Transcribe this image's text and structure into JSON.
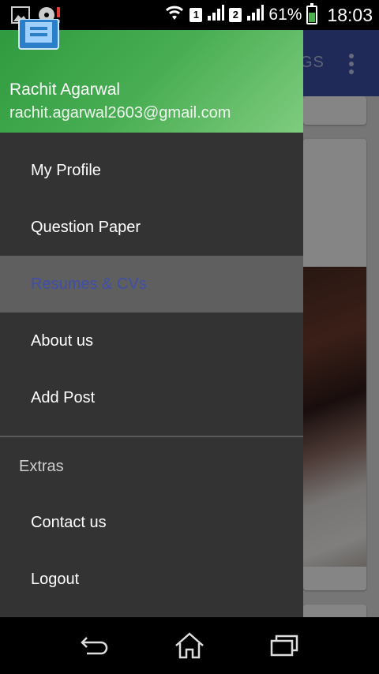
{
  "status_bar": {
    "sim1_label": "1",
    "sim2_label": "2",
    "battery_percent": "61%",
    "battery_level": 0.61,
    "time": "18:03"
  },
  "background_app": {
    "toolbar_tab_label": "GS",
    "toolbar_color": "#3a4ea0"
  },
  "drawer": {
    "header": {
      "user_name": "Rachit Agarwal",
      "user_email": "rachit.agarwal2603@gmail.com"
    },
    "items": [
      {
        "label": "My Profile",
        "active": false
      },
      {
        "label": "Question Paper",
        "active": false
      },
      {
        "label": "Resumes & CVs",
        "active": true
      },
      {
        "label": "About us",
        "active": false
      },
      {
        "label": "Add Post",
        "active": false
      }
    ],
    "extras_label": "Extras",
    "extras_items": [
      {
        "label": "Contact us"
      },
      {
        "label": "Logout"
      }
    ]
  },
  "icons": {
    "status_left": [
      "gallery-notification-icon",
      "disk-alert-icon"
    ],
    "status_right": [
      "wifi-icon",
      "sim1-signal-icon",
      "sim2-signal-icon",
      "battery-icon"
    ],
    "nav": [
      "back-icon",
      "home-icon",
      "recent-apps-icon"
    ]
  },
  "colors": {
    "drawer_bg": "#333333",
    "header_green": "#49ae53",
    "active_item_bg": "#5f5f5f",
    "active_item_text": "#3f4fa8"
  }
}
